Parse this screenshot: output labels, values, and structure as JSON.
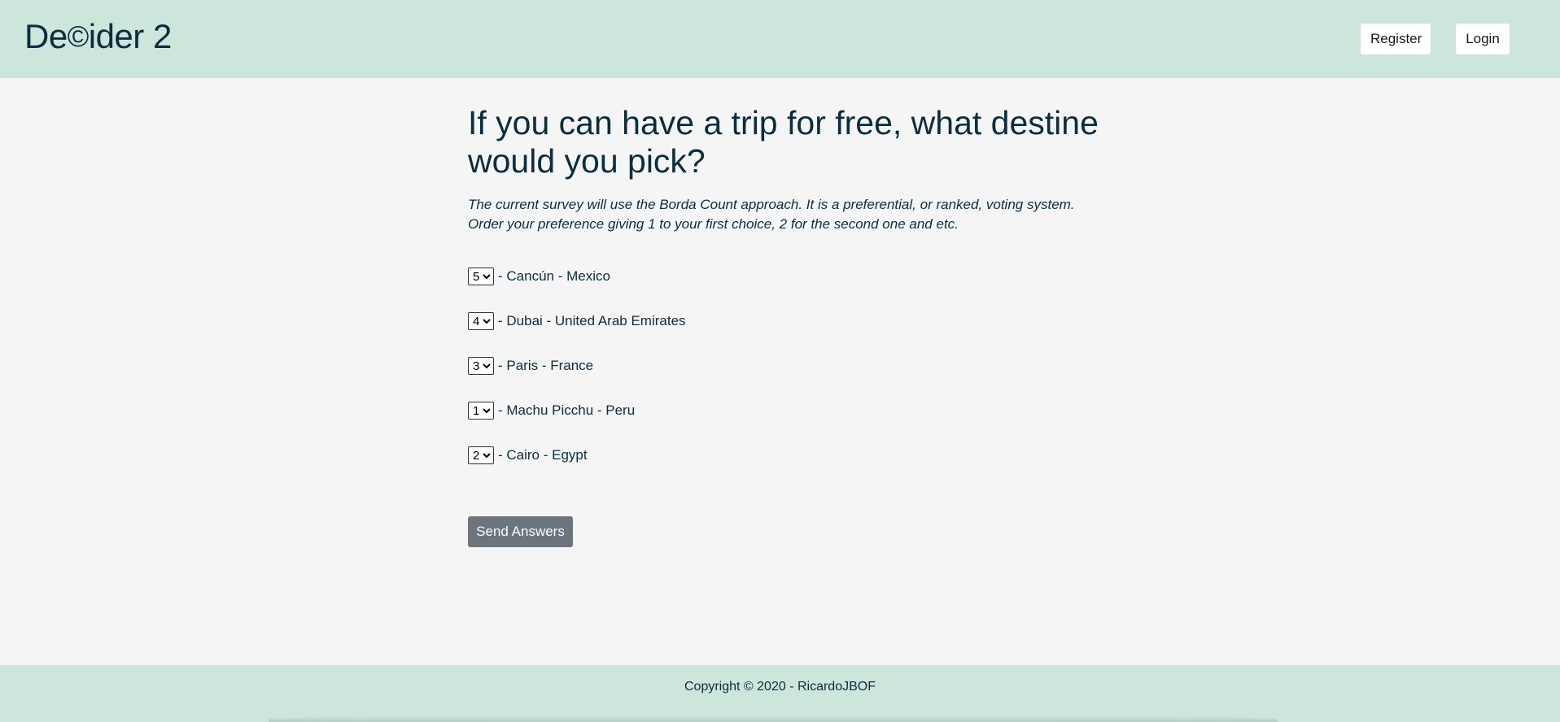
{
  "header": {
    "logo_prefix": "De",
    "logo_glyph": "©",
    "logo_suffix": "ider 2",
    "register_label": "Register",
    "login_label": "Login"
  },
  "survey": {
    "question": "If you can have a trip for free, what destine would you pick?",
    "description": "The current survey will use the Borda Count approach. It is a preferential, or ranked, voting system. Order your preference giving 1 to your first choice, 2 for the second one and etc.",
    "separator": "-",
    "options": [
      {
        "rank": "5",
        "label": "- Cancún - Mexico"
      },
      {
        "rank": "4",
        "label": "- Dubai - United Arab Emirates"
      },
      {
        "rank": "3",
        "label": "- Paris - France"
      },
      {
        "rank": "1",
        "label": "- Machu Picchu - Peru"
      },
      {
        "rank": "2",
        "label": "- Cairo - Egypt"
      }
    ],
    "rank_choices": [
      "1",
      "2",
      "3",
      "4",
      "5"
    ],
    "submit_label": "Send Answers"
  },
  "footer": {
    "copyright": "Copyright © 2020 - RicardoJBOF"
  },
  "colors": {
    "header_bg": "#cde6dc",
    "page_bg": "#f5f5f5",
    "text": "#0b2e3d",
    "submit_bg": "#6c757d"
  }
}
